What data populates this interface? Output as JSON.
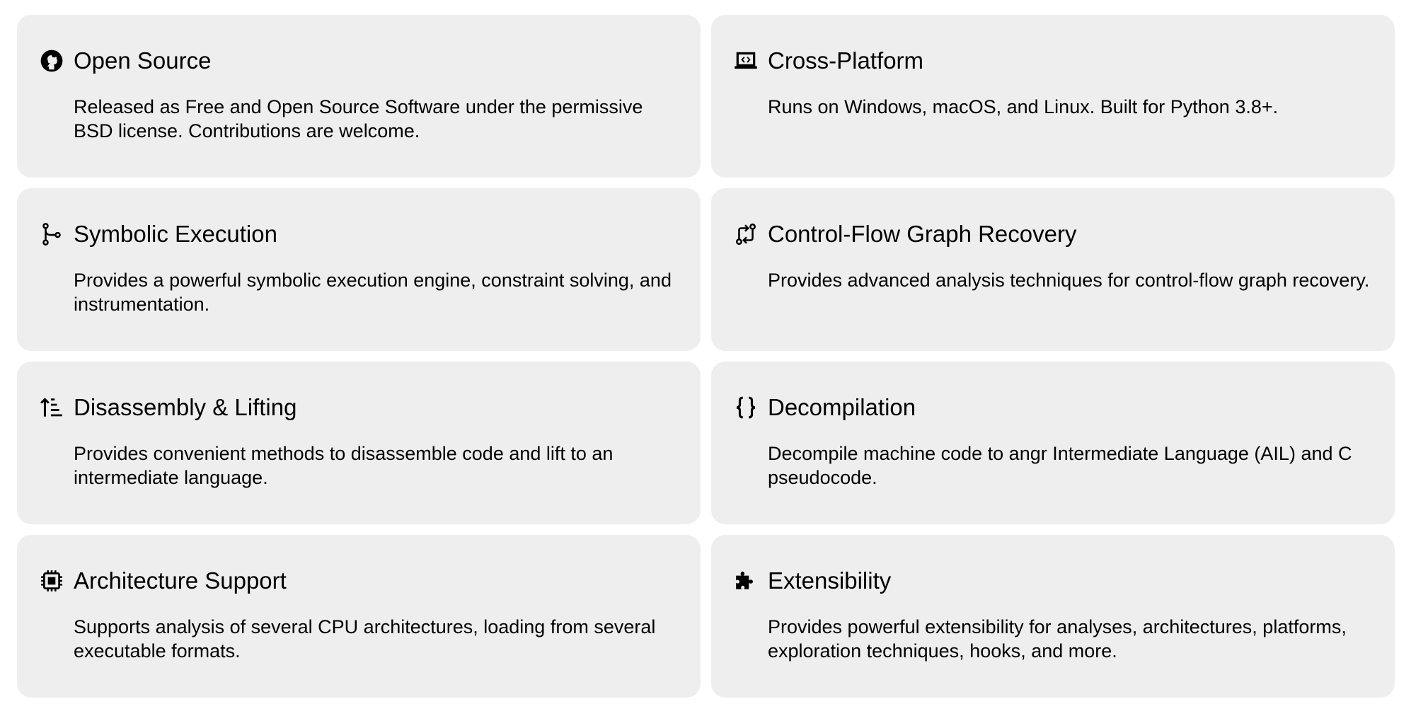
{
  "features": [
    {
      "icon": "github-icon",
      "title": "Open Source",
      "description": "Released as Free and Open Source Software under the permissive BSD license. Contributions are welcome."
    },
    {
      "icon": "laptop-code-icon",
      "title": "Cross-Platform",
      "description": "Runs on Windows, macOS, and Linux. Built for Python 3.8+."
    },
    {
      "icon": "code-branch-icon",
      "title": "Symbolic Execution",
      "description": "Provides a powerful symbolic execution engine, constraint solving, and instrumentation."
    },
    {
      "icon": "git-compare-icon",
      "title": "Control-Flow Graph Recovery",
      "description": "Provides advanced analysis techniques for control-flow graph recovery."
    },
    {
      "icon": "sort-arrow-up-list-icon",
      "title": "Disassembly & Lifting",
      "description": "Provides convenient methods to disassemble code and lift to an intermediate language."
    },
    {
      "icon": "curly-braces-icon",
      "title": "Decompilation",
      "description": "Decompile machine code to angr Intermediate Language (AIL) and C pseudocode."
    },
    {
      "icon": "cpu-chip-icon",
      "title": "Architecture Support",
      "description": "Supports analysis of several CPU architectures, loading from several executable formats."
    },
    {
      "icon": "puzzle-piece-icon",
      "title": "Extensibility",
      "description": "Provides powerful extensibility for analyses, architectures, platforms, exploration techniques, hooks, and more."
    }
  ]
}
